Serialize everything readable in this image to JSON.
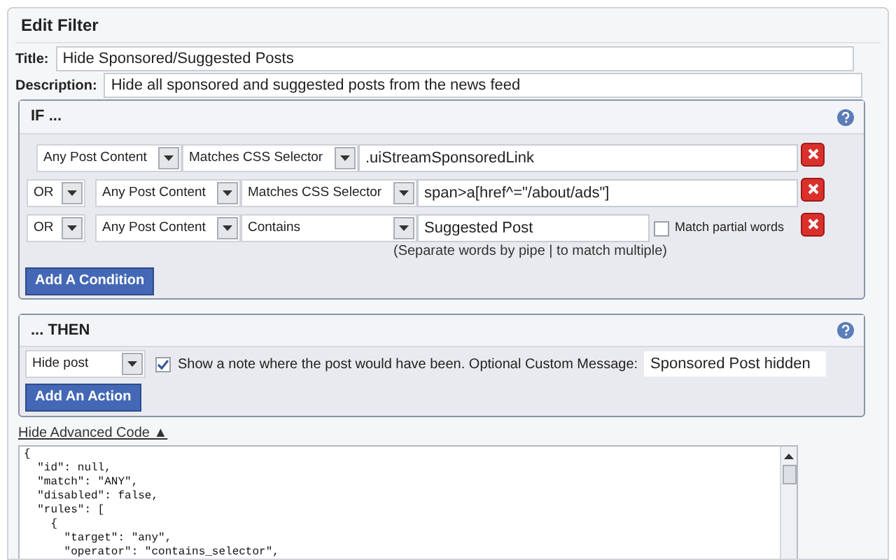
{
  "heading": "Edit Filter",
  "title_field": {
    "label": "Title:",
    "value": "Hide Sponsored/Suggested Posts"
  },
  "description_field": {
    "label": "Description:",
    "value": "Hide all sponsored and suggested posts from the news feed"
  },
  "if_section": {
    "heading": "IF ...",
    "conditions": [
      {
        "target": "Any Post Content",
        "operator": "Matches CSS Selector",
        "value": ".uiStreamSponsoredLink"
      },
      {
        "joiner": "OR",
        "target": "Any Post Content",
        "operator": "Matches CSS Selector",
        "value": "span>a[href^=\"/about/ads\"]"
      },
      {
        "joiner": "OR",
        "target": "Any Post Content",
        "operator": "Contains",
        "value": "Suggested Post",
        "partial": {
          "label": "Match partial words",
          "checked": false
        },
        "hint": "(Separate words by pipe | to match multiple)"
      }
    ],
    "add_button": "Add A Condition"
  },
  "then_section": {
    "heading": "... THEN",
    "action": "Hide post",
    "note": {
      "label": "Show a note where the post would have been. Optional Custom Message:",
      "checked": true,
      "value": "Sponsored Post hidden"
    },
    "add_button": "Add An Action"
  },
  "code_toggle": "Hide Advanced Code ▲",
  "code_lines": [
    "{",
    "  \"id\": null,",
    "  \"match\": \"ANY\",",
    "  \"disabled\": false,",
    "  \"rules\": [",
    "    {",
    "      \"target\": \"any\",",
    "      \"operator\": \"contains_selector\","
  ]
}
